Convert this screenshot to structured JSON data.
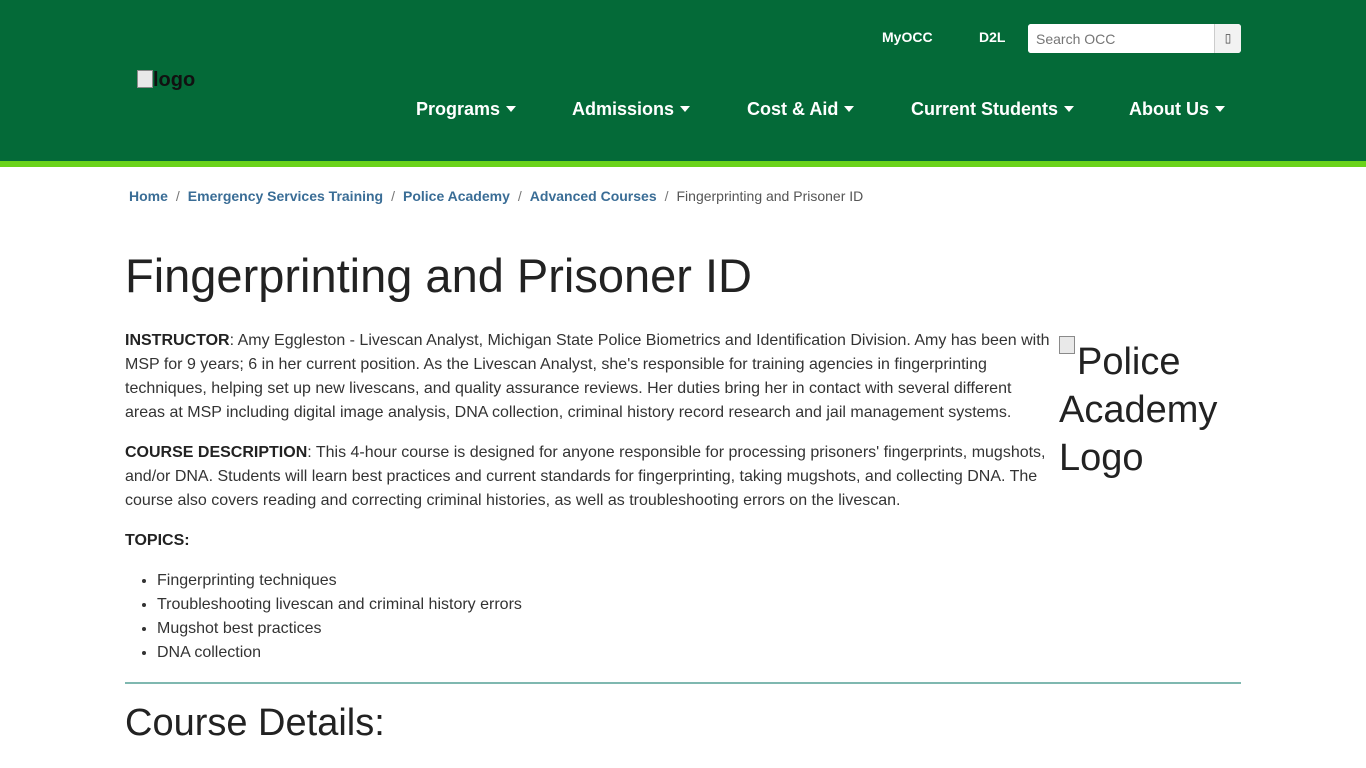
{
  "header": {
    "logo_alt": "logo",
    "utility_links": {
      "myocc": "MyOCC",
      "d2l": "D2L"
    },
    "search": {
      "placeholder": "Search OCC",
      "icon": "search-icon"
    },
    "nav": [
      "Programs",
      "Admissions",
      "Cost & Aid",
      "Current Students",
      "About Us"
    ],
    "colors": {
      "header_bg": "#046a38",
      "accent_stripe": "#6ad31a"
    }
  },
  "breadcrumb": {
    "items": [
      "Home",
      "Emergency Services Training",
      "Police Academy",
      "Advanced Courses"
    ],
    "separator": "/",
    "current": "Fingerprinting and Prisoner ID"
  },
  "page": {
    "title": "Fingerprinting and Prisoner ID",
    "instructor_label": "INSTRUCTOR",
    "instructor_text": ": Amy Eggleston - Livescan Analyst, Michigan State Police Biometrics and Identification Division. Amy has been with MSP for 9 years; 6 in her current position.  As the Livescan Analyst, she's responsible for training agencies in fingerprinting techniques, helping set up new livescans, and quality assurance reviews.  Her duties bring her in contact with several different areas at MSP including digital image analysis, DNA collection, criminal history record research and jail management systems.",
    "description_label": "COURSE DESCRIPTION",
    "description_text": ": This 4-hour course is designed for anyone responsible for processing prisoners' fingerprints, mugshots, and/or DNA. Students will learn best practices and current standards for fingerprinting, taking mugshots, and collecting DNA. The course also covers reading and correcting criminal histories, as well as troubleshooting errors on the livescan.",
    "topics_label": "TOPICS:",
    "topics": [
      "Fingerprinting techniques",
      "Troubleshooting livescan and criminal history errors",
      "Mugshot best practices",
      "DNA collection"
    ],
    "side_image_alt": "Police Academy Logo",
    "details_heading": "Course Details:"
  }
}
